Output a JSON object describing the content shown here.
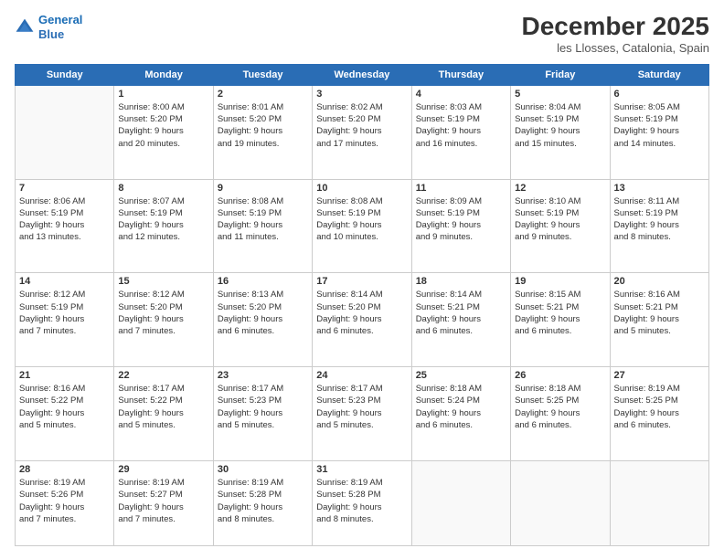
{
  "logo": {
    "line1": "General",
    "line2": "Blue"
  },
  "header": {
    "title": "December 2025",
    "location": "les Llosses, Catalonia, Spain"
  },
  "weekdays": [
    "Sunday",
    "Monday",
    "Tuesday",
    "Wednesday",
    "Thursday",
    "Friday",
    "Saturday"
  ],
  "weeks": [
    [
      {
        "day": "",
        "info": ""
      },
      {
        "day": "1",
        "info": "Sunrise: 8:00 AM\nSunset: 5:20 PM\nDaylight: 9 hours\nand 20 minutes."
      },
      {
        "day": "2",
        "info": "Sunrise: 8:01 AM\nSunset: 5:20 PM\nDaylight: 9 hours\nand 19 minutes."
      },
      {
        "day": "3",
        "info": "Sunrise: 8:02 AM\nSunset: 5:20 PM\nDaylight: 9 hours\nand 17 minutes."
      },
      {
        "day": "4",
        "info": "Sunrise: 8:03 AM\nSunset: 5:19 PM\nDaylight: 9 hours\nand 16 minutes."
      },
      {
        "day": "5",
        "info": "Sunrise: 8:04 AM\nSunset: 5:19 PM\nDaylight: 9 hours\nand 15 minutes."
      },
      {
        "day": "6",
        "info": "Sunrise: 8:05 AM\nSunset: 5:19 PM\nDaylight: 9 hours\nand 14 minutes."
      }
    ],
    [
      {
        "day": "7",
        "info": "Sunrise: 8:06 AM\nSunset: 5:19 PM\nDaylight: 9 hours\nand 13 minutes."
      },
      {
        "day": "8",
        "info": "Sunrise: 8:07 AM\nSunset: 5:19 PM\nDaylight: 9 hours\nand 12 minutes."
      },
      {
        "day": "9",
        "info": "Sunrise: 8:08 AM\nSunset: 5:19 PM\nDaylight: 9 hours\nand 11 minutes."
      },
      {
        "day": "10",
        "info": "Sunrise: 8:08 AM\nSunset: 5:19 PM\nDaylight: 9 hours\nand 10 minutes."
      },
      {
        "day": "11",
        "info": "Sunrise: 8:09 AM\nSunset: 5:19 PM\nDaylight: 9 hours\nand 9 minutes."
      },
      {
        "day": "12",
        "info": "Sunrise: 8:10 AM\nSunset: 5:19 PM\nDaylight: 9 hours\nand 9 minutes."
      },
      {
        "day": "13",
        "info": "Sunrise: 8:11 AM\nSunset: 5:19 PM\nDaylight: 9 hours\nand 8 minutes."
      }
    ],
    [
      {
        "day": "14",
        "info": "Sunrise: 8:12 AM\nSunset: 5:19 PM\nDaylight: 9 hours\nand 7 minutes."
      },
      {
        "day": "15",
        "info": "Sunrise: 8:12 AM\nSunset: 5:20 PM\nDaylight: 9 hours\nand 7 minutes."
      },
      {
        "day": "16",
        "info": "Sunrise: 8:13 AM\nSunset: 5:20 PM\nDaylight: 9 hours\nand 6 minutes."
      },
      {
        "day": "17",
        "info": "Sunrise: 8:14 AM\nSunset: 5:20 PM\nDaylight: 9 hours\nand 6 minutes."
      },
      {
        "day": "18",
        "info": "Sunrise: 8:14 AM\nSunset: 5:21 PM\nDaylight: 9 hours\nand 6 minutes."
      },
      {
        "day": "19",
        "info": "Sunrise: 8:15 AM\nSunset: 5:21 PM\nDaylight: 9 hours\nand 6 minutes."
      },
      {
        "day": "20",
        "info": "Sunrise: 8:16 AM\nSunset: 5:21 PM\nDaylight: 9 hours\nand 5 minutes."
      }
    ],
    [
      {
        "day": "21",
        "info": "Sunrise: 8:16 AM\nSunset: 5:22 PM\nDaylight: 9 hours\nand 5 minutes."
      },
      {
        "day": "22",
        "info": "Sunrise: 8:17 AM\nSunset: 5:22 PM\nDaylight: 9 hours\nand 5 minutes."
      },
      {
        "day": "23",
        "info": "Sunrise: 8:17 AM\nSunset: 5:23 PM\nDaylight: 9 hours\nand 5 minutes."
      },
      {
        "day": "24",
        "info": "Sunrise: 8:17 AM\nSunset: 5:23 PM\nDaylight: 9 hours\nand 5 minutes."
      },
      {
        "day": "25",
        "info": "Sunrise: 8:18 AM\nSunset: 5:24 PM\nDaylight: 9 hours\nand 6 minutes."
      },
      {
        "day": "26",
        "info": "Sunrise: 8:18 AM\nSunset: 5:25 PM\nDaylight: 9 hours\nand 6 minutes."
      },
      {
        "day": "27",
        "info": "Sunrise: 8:19 AM\nSunset: 5:25 PM\nDaylight: 9 hours\nand 6 minutes."
      }
    ],
    [
      {
        "day": "28",
        "info": "Sunrise: 8:19 AM\nSunset: 5:26 PM\nDaylight: 9 hours\nand 7 minutes."
      },
      {
        "day": "29",
        "info": "Sunrise: 8:19 AM\nSunset: 5:27 PM\nDaylight: 9 hours\nand 7 minutes."
      },
      {
        "day": "30",
        "info": "Sunrise: 8:19 AM\nSunset: 5:28 PM\nDaylight: 9 hours\nand 8 minutes."
      },
      {
        "day": "31",
        "info": "Sunrise: 8:19 AM\nSunset: 5:28 PM\nDaylight: 9 hours\nand 8 minutes."
      },
      {
        "day": "",
        "info": ""
      },
      {
        "day": "",
        "info": ""
      },
      {
        "day": "",
        "info": ""
      }
    ]
  ]
}
